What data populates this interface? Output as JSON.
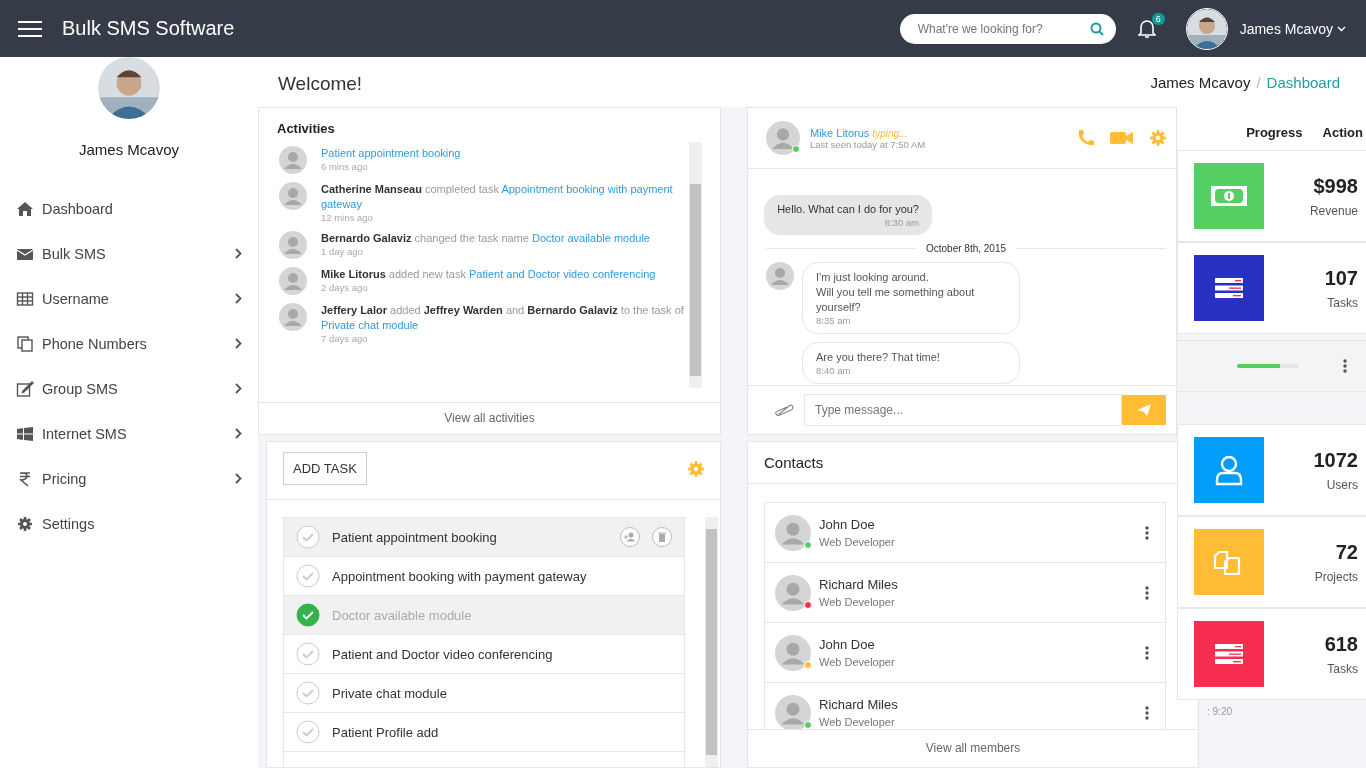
{
  "topbar": {
    "title": "Bulk SMS Software",
    "search": {
      "placeholder": "What're we looking for?"
    },
    "notifications": "6",
    "user": "James Mcavoy"
  },
  "sidebar": {
    "user": "James Mcavoy",
    "items": [
      {
        "label": "Dashboard",
        "kind": "home",
        "submenu": false
      },
      {
        "label": "Bulk SMS",
        "kind": "mail",
        "submenu": true
      },
      {
        "label": "Username",
        "kind": "grid",
        "submenu": true
      },
      {
        "label": "Phone Numbers",
        "kind": "copy",
        "submenu": true
      },
      {
        "label": "Group SMS",
        "kind": "edit",
        "submenu": true
      },
      {
        "label": "Internet SMS",
        "kind": "windows",
        "submenu": true
      },
      {
        "label": "Pricing",
        "kind": "rupee",
        "submenu": true
      },
      {
        "label": "Settings",
        "kind": "gear",
        "submenu": false
      }
    ]
  },
  "page": {
    "title": "Welcome!",
    "breadcrumb": [
      "James Mcavoy",
      "Dashboard"
    ],
    "breadcrumb_separator": "/"
  },
  "activities": {
    "title": "Activities",
    "items": [
      {
        "parts": [
          {
            "kind": "link",
            "text": "Patient appointment booking"
          }
        ],
        "time": "6 mins ago"
      },
      {
        "parts": [
          {
            "kind": "name",
            "text": "Catherine Manseau"
          },
          {
            "kind": "verb",
            "text": "completed task"
          },
          {
            "kind": "link",
            "text": "Appointment booking with payment gateway"
          }
        ],
        "time": "12 mins ago"
      },
      {
        "parts": [
          {
            "kind": "name",
            "text": "Bernardo Galaviz"
          },
          {
            "kind": "verb",
            "text": "changed the task name"
          },
          {
            "kind": "link",
            "text": "Doctor available module"
          }
        ],
        "time": "1 day ago"
      },
      {
        "parts": [
          {
            "kind": "name",
            "text": "Mike Litorus"
          },
          {
            "kind": "verb",
            "text": "added new task"
          },
          {
            "kind": "link",
            "text": "Patient and Doctor video conferencing"
          }
        ],
        "time": "2 days ago"
      },
      {
        "parts": [
          {
            "kind": "name",
            "text": "Jeffery Lalor"
          },
          {
            "kind": "verb",
            "text": "added"
          },
          {
            "kind": "name",
            "text": "Jeffrey Warden"
          },
          {
            "kind": "verb",
            "text": "and"
          },
          {
            "kind": "name",
            "text": "Bernardo Galaviz"
          },
          {
            "kind": "verb",
            "text": "to the task of"
          },
          {
            "kind": "link",
            "text": "Private chat module"
          }
        ],
        "time": "7 days ago"
      }
    ],
    "footer": "View all activities"
  },
  "chat": {
    "name": "Mike Litorus",
    "status": "typing...",
    "last_seen": "Last seen today at 7:50 AM",
    "messages": [
      {
        "kind": "sent",
        "text": "Hello. What can I do for you?",
        "time": "8:30 am"
      },
      {
        "kind": "date",
        "text": "October 8th, 2015"
      },
      {
        "kind": "received",
        "text": "I'm just looking around.\nWill you tell me something about yourself?",
        "time": "8:35 am",
        "avatar": true
      },
      {
        "kind": "received",
        "text": "Are you there? That time!",
        "time": "8:40 am",
        "avatar": false
      }
    ],
    "input": {
      "placeholder": "Type message..."
    }
  },
  "tasks": {
    "add_button": "ADD TASK",
    "items": [
      {
        "label": "Patient appointment booking",
        "completed": false,
        "selected": true
      },
      {
        "label": "Appointment booking with payment gateway",
        "completed": false,
        "selected": false
      },
      {
        "label": "Doctor available module",
        "completed": true,
        "selected": false
      },
      {
        "label": "Patient and Doctor video conferencing",
        "completed": false,
        "selected": false
      },
      {
        "label": "Private chat module",
        "completed": false,
        "selected": false
      },
      {
        "label": "Patient Profile add",
        "completed": false,
        "selected": false
      }
    ]
  },
  "contacts": {
    "title": "Contacts",
    "items": [
      {
        "name": "John Doe",
        "role": "Web Developer",
        "color": "#55ce63"
      },
      {
        "name": "Richard Miles",
        "role": "Web Developer",
        "color": "#f62d51"
      },
      {
        "name": "John Doe",
        "role": "Web Developer",
        "color": "#ffbc34"
      },
      {
        "name": "Richard Miles",
        "role": "Web Developer",
        "color": "#55ce63"
      }
    ],
    "footer": "View all members"
  },
  "table": {
    "columns": [
      "Progress",
      "Action"
    ],
    "rows": [
      {
        "level": 0.7
      }
    ]
  },
  "stats": [
    {
      "kind": "money",
      "color": "#55ce63",
      "value": "$998",
      "label": "Revenue"
    },
    {
      "kind": "list",
      "color": "#2a2fc4",
      "value": "107",
      "label": "Tasks"
    },
    {
      "kind": "user",
      "color": "#009efb",
      "value": "1072",
      "label": "Users"
    },
    {
      "kind": "files",
      "color": "#ffbc34",
      "value": "72",
      "label": "Projects"
    },
    {
      "kind": "list",
      "color": "#f62d51",
      "value": "618",
      "label": "Tasks"
    }
  ],
  "chat_fragment": ": 9:20"
}
